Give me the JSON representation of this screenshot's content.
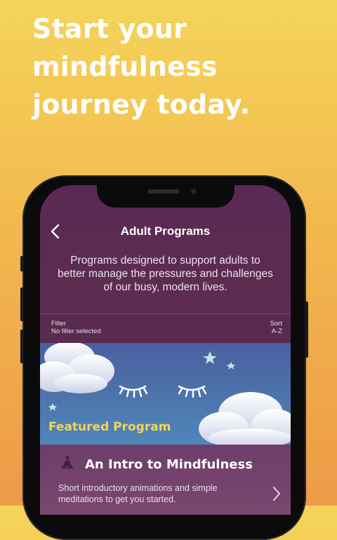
{
  "headline": {
    "line1": "Start your",
    "line2": "mindfulness",
    "line3": "journey today."
  },
  "app": {
    "nav_title": "Adult Programs",
    "description": "Programs designed to support adults to better manage the pressures and challenges of our busy, modern lives.",
    "filter": {
      "label": "Filter",
      "value": "No filter selected"
    },
    "sort": {
      "label": "Sort",
      "value": "A-Z"
    },
    "featured": {
      "label": "Featured Program"
    },
    "program": {
      "title": "An Intro to Mindfulness",
      "description": "Short introductory animations and simple meditations to get you started."
    }
  },
  "colors": {
    "background_top": "#f5d45a",
    "background_bottom": "#ee9a47",
    "header_purple": "#5a2a52",
    "featured_yellow": "#f6d64c",
    "card_purple": "#6e3d6a"
  },
  "icons": {
    "back": "chevron-left-icon",
    "program": "meditation-person-icon",
    "card_action": "chevron-right-icon"
  }
}
